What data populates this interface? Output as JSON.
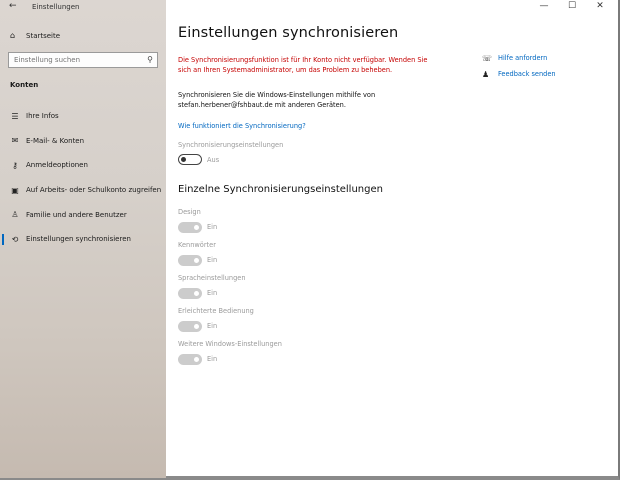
{
  "window": {
    "app_title": "Einstellungen"
  },
  "sidebar": {
    "home_label": "Startseite",
    "search_placeholder": "Einstellung suchen",
    "section_header": "Konten",
    "items": [
      {
        "label": "Ihre Infos",
        "icon": "person-card-icon",
        "active": false
      },
      {
        "label": "E-Mail- & Konten",
        "icon": "mail-icon",
        "active": false
      },
      {
        "label": "Anmeldeoptionen",
        "icon": "key-icon",
        "active": false
      },
      {
        "label": "Auf Arbeits- oder Schulkonto zugreifen",
        "icon": "briefcase-icon",
        "active": false
      },
      {
        "label": "Familie und andere Benutzer",
        "icon": "add-person-icon",
        "active": false
      },
      {
        "label": "Einstellungen synchronisieren",
        "icon": "sync-icon",
        "active": true
      }
    ]
  },
  "main": {
    "title": "Einstellungen synchronisieren",
    "error_text": "Die Synchronisierungsfunktion ist für Ihr Konto nicht verfügbar. Wenden Sie sich an Ihren Systemadministrator, um das Problem zu beheben.",
    "description": "Synchronisieren Sie die Windows-Einstellungen mithilfe von stefan.herbener@fshbaut.de mit anderen Geräten.",
    "how_link": "Wie funktioniert die Synchronisierung?",
    "sync_setting": {
      "label": "Synchronisierungseinstellungen",
      "state": "Aus"
    },
    "section_title": "Einzelne Synchronisierungseinstellungen",
    "individual": [
      {
        "label": "Design",
        "state": "Ein"
      },
      {
        "label": "Kennwörter",
        "state": "Ein"
      },
      {
        "label": "Spracheinstellungen",
        "state": "Ein"
      },
      {
        "label": "Erleichterte Bedienung",
        "state": "Ein"
      },
      {
        "label": "Weitere Windows-Einstellungen",
        "state": "Ein"
      }
    ],
    "help_links": [
      {
        "label": "Hilfe anfordern",
        "icon": "help-chat-icon"
      },
      {
        "label": "Feedback senden",
        "icon": "feedback-icon"
      }
    ]
  },
  "colors": {
    "accent": "#0067c0",
    "error": "#c50000",
    "disabled_text": "#9a9a9a"
  }
}
